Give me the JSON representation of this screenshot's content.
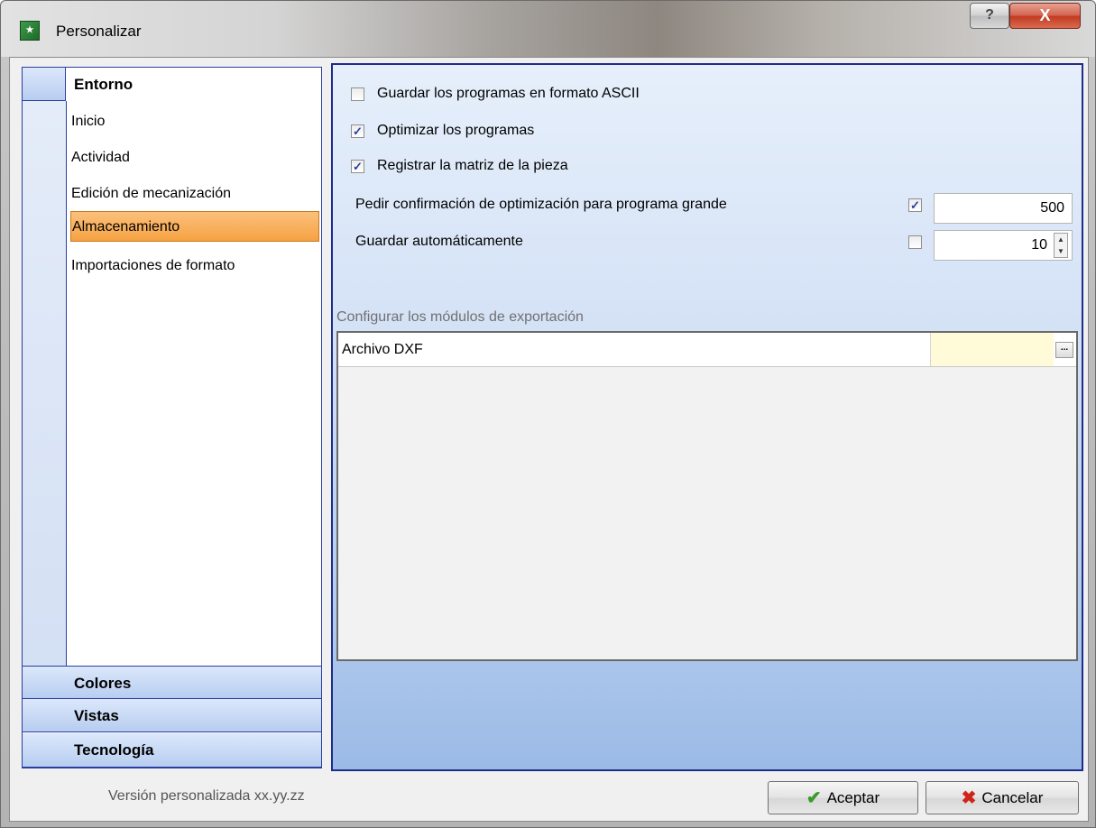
{
  "window": {
    "title": "Personalizar",
    "icon": "app-logo-icon",
    "help_label": "?",
    "close_label": "X"
  },
  "nav": {
    "sections": [
      {
        "label": "Entorno",
        "expanded": true
      },
      {
        "label": "Colores",
        "expanded": false
      },
      {
        "label": "Vistas",
        "expanded": false
      },
      {
        "label": "Tecnología",
        "expanded": false
      }
    ],
    "items": [
      {
        "label": "Inicio",
        "selected": false
      },
      {
        "label": "Actividad",
        "selected": false
      },
      {
        "label": "Edición de mecanización",
        "selected": false
      },
      {
        "label": "Almacenamiento",
        "selected": true
      },
      {
        "label": "Importaciones de formato",
        "selected": false
      }
    ]
  },
  "options": {
    "save_ascii": {
      "label": "Guardar los programas en formato ASCII",
      "checked": false
    },
    "optimize": {
      "label": "Optimizar los programas",
      "checked": true
    },
    "register_matrix": {
      "label": "Registrar la matriz de la pieza",
      "checked": true
    },
    "confirm_optimization": {
      "label": "Pedir confirmación de optimización para programa grande",
      "checked": true,
      "value": "500"
    },
    "autosave": {
      "label": "Guardar automáticamente",
      "checked": false,
      "value": "10"
    }
  },
  "export": {
    "section_label": "Configurar los módulos de exportación",
    "rows": [
      {
        "name": "Archivo DXF",
        "value": "",
        "button_label": "..."
      }
    ]
  },
  "footer": {
    "version_text": "Versión personalizada xx.yy.zz",
    "ok_label": "Aceptar",
    "cancel_label": "Cancelar"
  },
  "colors": {
    "selection": "#f5a242",
    "nav_border": "#2a3ea0",
    "panel_border": "#1e2d8a",
    "grid_value_bg": "#fffbd9"
  }
}
